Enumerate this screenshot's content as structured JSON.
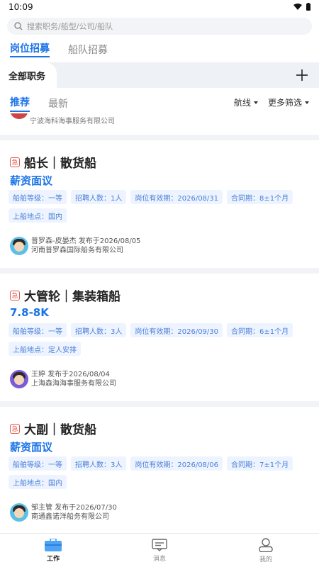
{
  "status": {
    "time": "10:09"
  },
  "search": {
    "placeholder": "搜索职务/船型/公司/船队"
  },
  "top_tabs": [
    "岗位招募",
    "船队招募"
  ],
  "category_tab": "全部职务",
  "sub_tabs": [
    "推荐",
    "最新"
  ],
  "filters": [
    "航线",
    "更多筛选"
  ],
  "partial_card": {
    "company": "宁波海科海事服务有限公司"
  },
  "jobs": [
    {
      "urgent_label": "急",
      "title": "船长｜散货船",
      "salary": "薪资面议",
      "tags": [
        "船舶等级：一等",
        "招聘人数：1人",
        "岗位有效期：2026/08/31",
        "合同期：8±1个月",
        "上船地点：国内"
      ],
      "publisher": "普罗森-皮晏杰 发布于2026/08/05",
      "company": "河南普罗森国际船务有限公司"
    },
    {
      "urgent_label": "急",
      "title": "大管轮｜集装箱船",
      "salary": "7.8-8K",
      "tags": [
        "船舶等级：一等",
        "招聘人数：3人",
        "岗位有效期：2026/09/30",
        "合同期：6±1个月",
        "上船地点：定人安排"
      ],
      "publisher": "王婷 发布于2026/08/04",
      "company": "上海森海海事服务有限公司"
    },
    {
      "urgent_label": "急",
      "title": "大副｜散货船",
      "salary": "薪资面议",
      "tags": [
        "船舶等级：一等",
        "招聘人数：3人",
        "岗位有效期：2026/08/06",
        "合同期：7±1个月",
        "上船地点：国内"
      ],
      "publisher": "邹主管 发布于2026/07/30",
      "company": "南通鑫诺洋船务有限公司"
    }
  ],
  "bottom_nav": [
    "工作",
    "消息",
    "我的"
  ],
  "colors": {
    "accent": "#1a73e8",
    "urgent": "#e05a4f",
    "tag_bg": "#eef4ff"
  }
}
